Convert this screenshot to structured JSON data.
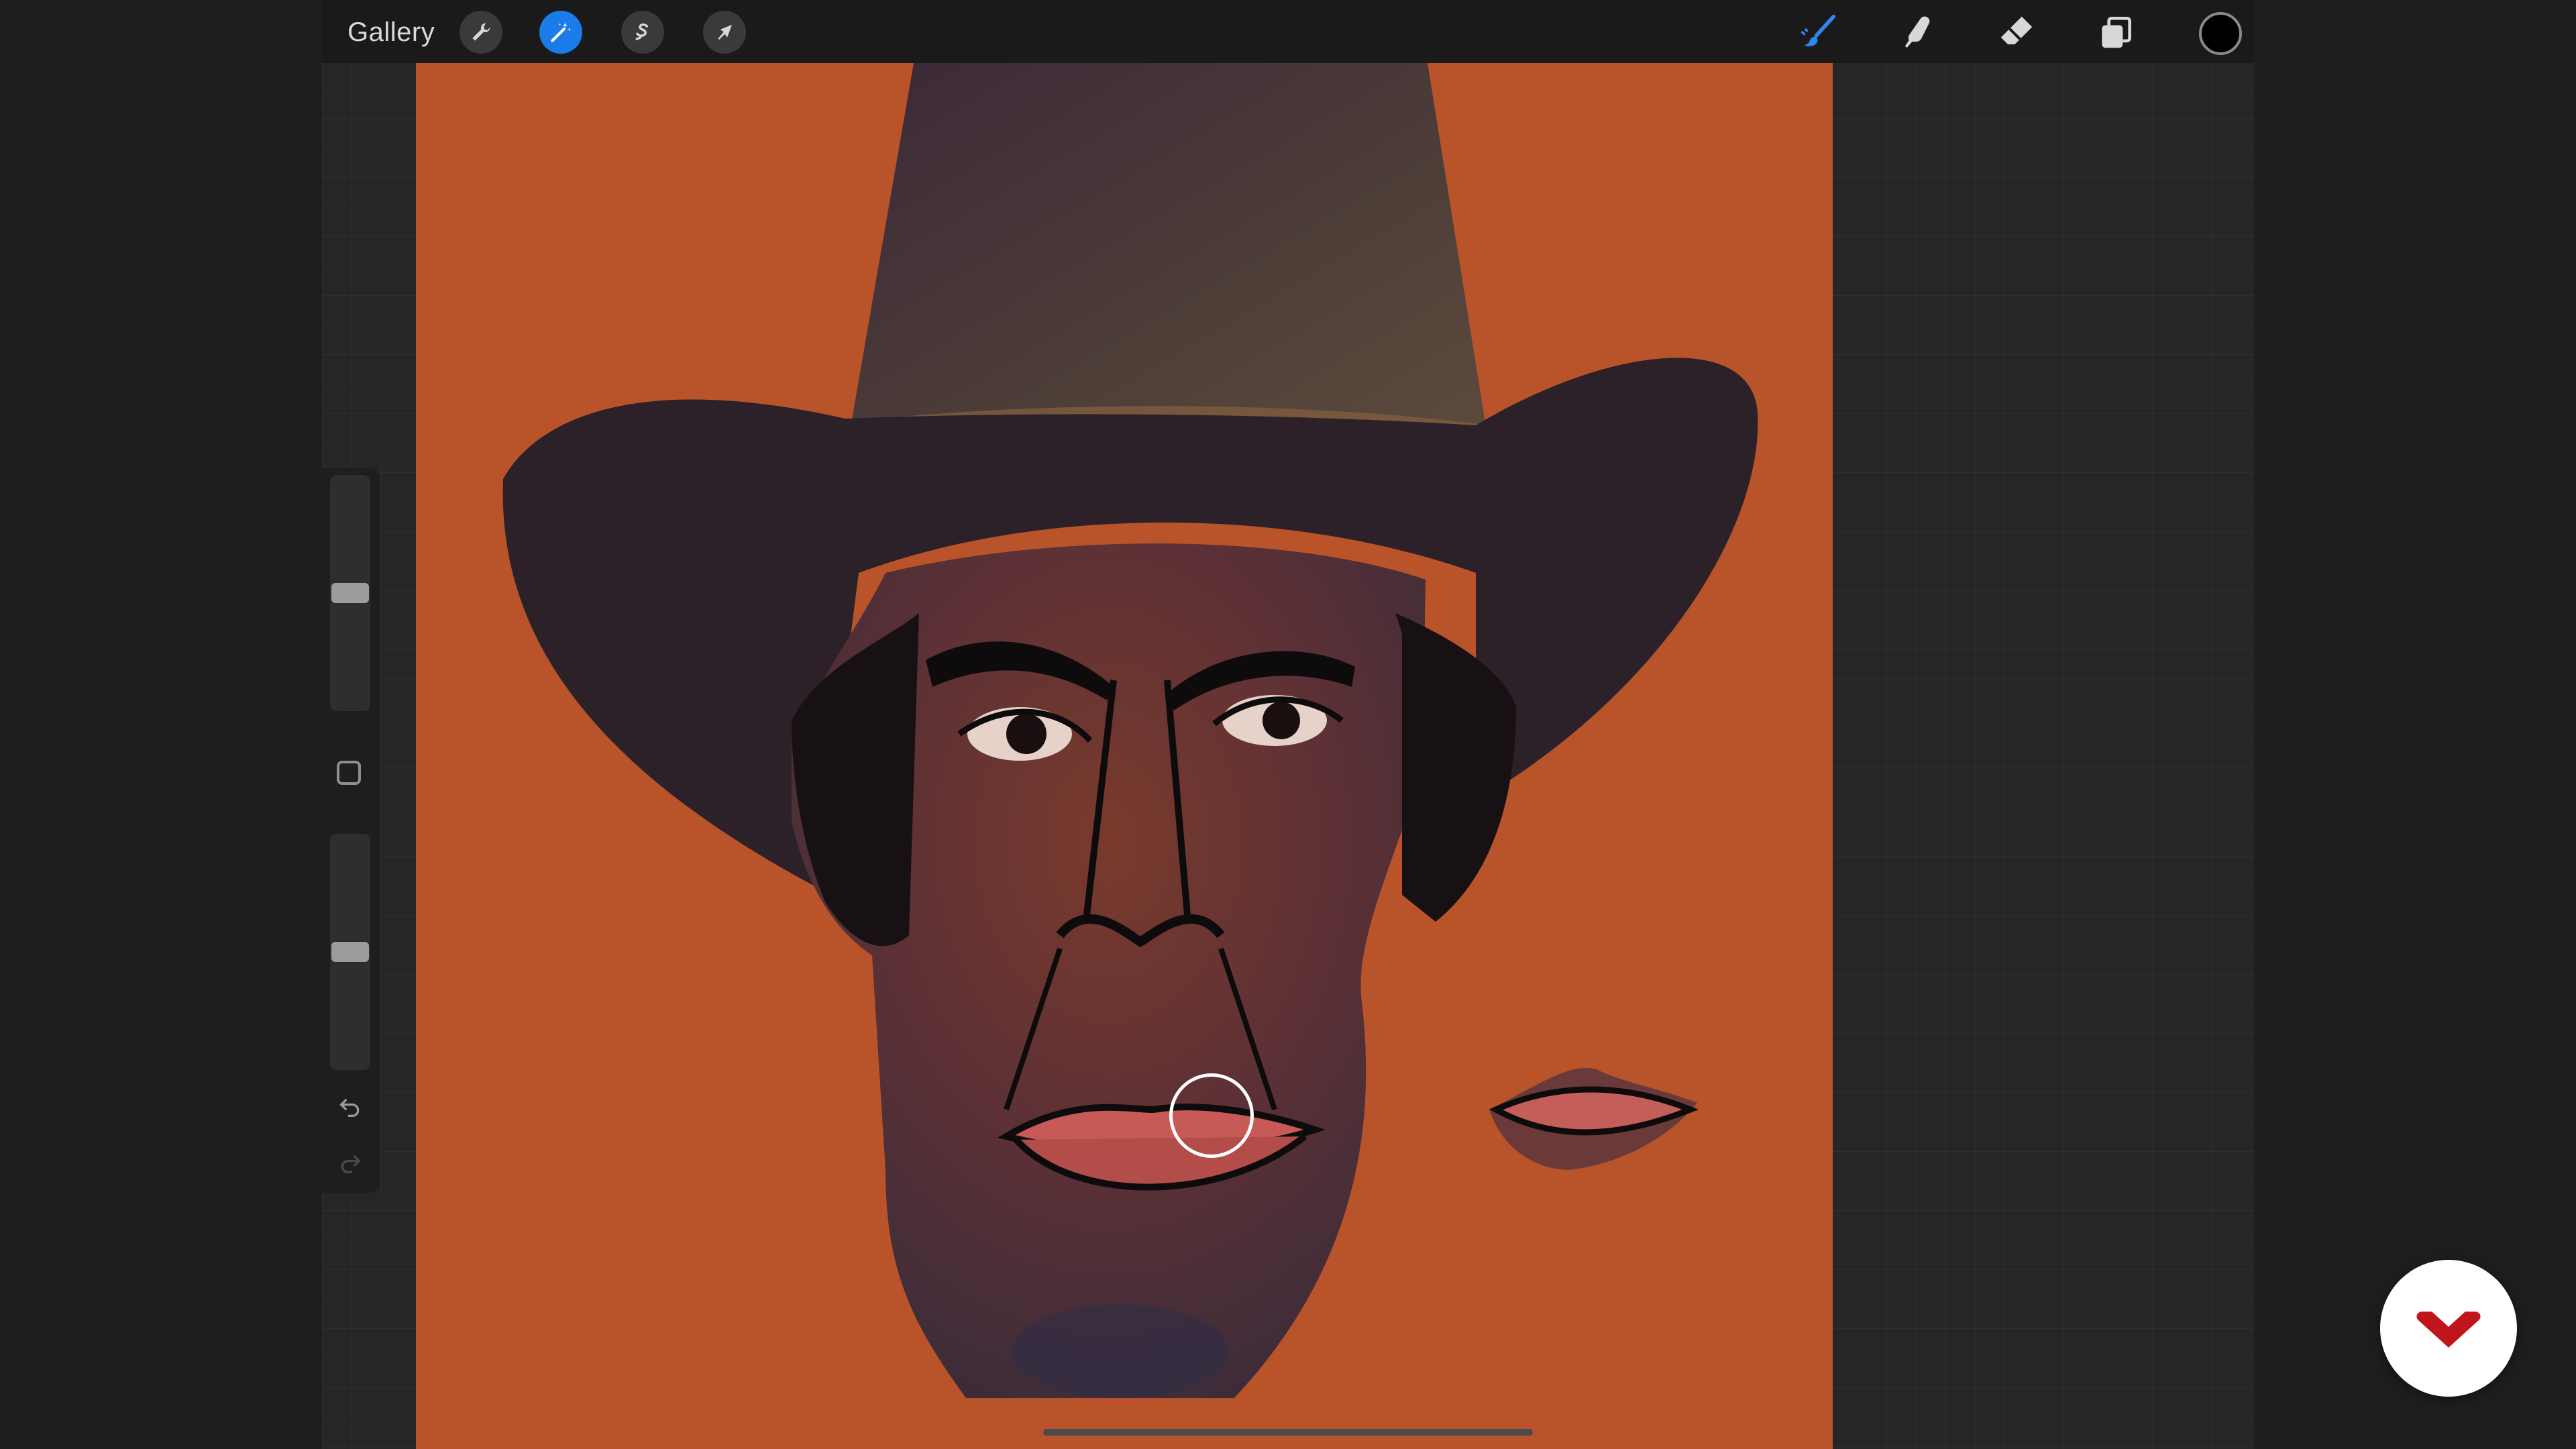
{
  "toolbar": {
    "gallery_label": "Gallery",
    "left_tools": [
      {
        "name": "actions",
        "icon": "wrench-icon"
      },
      {
        "name": "adjustments",
        "icon": "magic-wand-icon",
        "active": true
      },
      {
        "name": "selection",
        "icon": "selection-s-icon"
      },
      {
        "name": "transform",
        "icon": "arrow-cursor-icon"
      }
    ],
    "right_tools": [
      {
        "name": "brush",
        "icon": "paintbrush-icon",
        "active": true
      },
      {
        "name": "smudge",
        "icon": "smudge-icon"
      },
      {
        "name": "eraser",
        "icon": "eraser-icon"
      },
      {
        "name": "layers",
        "icon": "layers-icon"
      }
    ],
    "current_color": "#000000",
    "accent_color": "#1a7ce8"
  },
  "sidebar": {
    "brush_size_level": 0.5,
    "opacity_level": 0.5
  },
  "canvas": {
    "background_color": "#b9542a"
  },
  "watermark": {
    "logo_icon": "domestika-logo-icon",
    "logo_color": "#c0161b"
  }
}
